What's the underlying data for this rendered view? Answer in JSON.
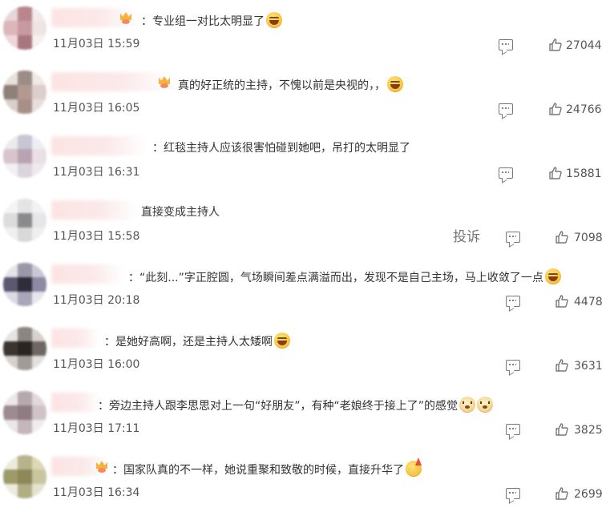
{
  "comments": [
    {
      "text": "：专业组一对比太明显了",
      "emoji": "laugh",
      "crown": true,
      "time": "11月03日 15:59",
      "likes": "27044",
      "avatar_colors": [
        "#e8d6d9",
        "#b9868d",
        "#f3eaea",
        "#dcb6ba",
        "#c89aa0",
        "#f0e3e4",
        "#eed7db",
        "#a7777f",
        "#f7efef"
      ]
    },
    {
      "text": "真的好正统的主持，不愧以前是央视的，，",
      "emoji": "laugh",
      "crown": true,
      "time": "11月03日 16:05",
      "likes": "24766",
      "avatar_colors": [
        "#e9e1dd",
        "#9b8c86",
        "#efe9e7",
        "#8e7f79",
        "#b29a91",
        "#dccfcb",
        "#d8d0cd",
        "#a88f87",
        "#e8dfdc"
      ]
    },
    {
      "text": "：红毯主持人应该很害怕碰到她吧，吊打的太明显了",
      "emoji": "",
      "crown": false,
      "time": "11月03日 16:31",
      "likes": "15881",
      "avatar_colors": [
        "#eaeaf0",
        "#c7c6d4",
        "#f0eef2",
        "#d8c4cc",
        "#b7a4b2",
        "#e9dfe5",
        "#f2f0f4",
        "#dcd4dc",
        "#eeeaf0"
      ]
    },
    {
      "text": "直接变成主持人",
      "emoji": "",
      "crown": false,
      "time": "11月03日 15:58",
      "likes": "7098",
      "report": "投诉",
      "avatar_colors": [
        "#f4f4f4",
        "#e4e4e6",
        "#f2f2f3",
        "#dcdcde",
        "#8a8a8e",
        "#e6e6e8",
        "#f0f0f1",
        "#d9d9db",
        "#efeff0"
      ]
    },
    {
      "text": "：“此刻...”字正腔圆，气场瞬间差点满溢而出，发现不是自己主场，马上收敛了一点",
      "emoji": "laugh",
      "crown": false,
      "time": "11月03日 20:18",
      "likes": "4478",
      "avatar_colors": [
        "#e3e3e8",
        "#9a98a8",
        "#cbc8d6",
        "#5b5870",
        "#2f2c3c",
        "#8d8aa6",
        "#dcdae4",
        "#a9a6b8",
        "#e7e6ec"
      ]
    },
    {
      "text": "：是她好高啊，还是主持人太矮啊",
      "emoji": "laugh",
      "crown": false,
      "time": "11月03日 16:00",
      "likes": "3631",
      "avatar_colors": [
        "#e6e4e2",
        "#8c8580",
        "#d7d2ce",
        "#3b3531",
        "#2a2522",
        "#6f6862",
        "#d6d1cc",
        "#a29a94",
        "#e3dfdc"
      ]
    },
    {
      "text": "：旁边主持人跟李思思对上一句“好朋友”，有种“老娘终于接上了”的感觉",
      "emoji": "doge2",
      "crown": false,
      "time": "11月03日 17:11",
      "likes": "3825",
      "avatar_colors": [
        "#ece8ea",
        "#b6a9ae",
        "#e2d9dc",
        "#9e8a91",
        "#8f7b82",
        "#cfc3c7",
        "#ebe6e8",
        "#c4b6bb",
        "#f0ecee"
      ]
    },
    {
      "text": "：国家队真的不一样，她说重聚和致敬的时候，直接升华了",
      "emoji": "party",
      "crown": true,
      "time": "11月03日 16:34",
      "likes": "2699",
      "avatar_colors": [
        "#ecebdc",
        "#b7b38a",
        "#dcd8b4",
        "#9e9a6a",
        "#8c8858",
        "#c9c59f",
        "#eeece0",
        "#b1ad84",
        "#e6e3cc"
      ]
    }
  ],
  "colors": {
    "text": "#333333",
    "meta": "#555555",
    "icon": "#777777",
    "crown": "#f6b23c"
  }
}
